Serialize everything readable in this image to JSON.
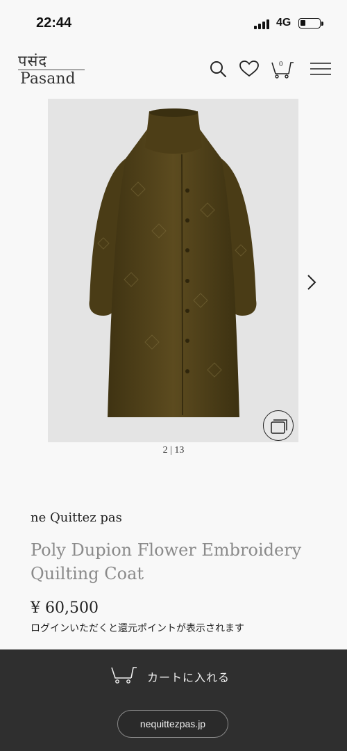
{
  "status_bar": {
    "time": "22:44",
    "network": "4G",
    "battery_level": 0.2
  },
  "header": {
    "logo_hindi": "पसंद",
    "logo_latin": "Pasand",
    "cart_count": "0",
    "icons": [
      "search-icon",
      "heart-icon",
      "cart-icon",
      "menu-icon"
    ]
  },
  "gallery": {
    "page_indicator": "2 | 13",
    "current": 2,
    "total": 13
  },
  "product": {
    "brand": "ne Quittez pas",
    "title": "Poly Dupion Flower Embroidery Quilting Coat",
    "price": "¥ 60,500",
    "points_note": "ログインいただくと還元ポイントが表示されます"
  },
  "bottom_bar": {
    "add_to_cart_label": "カートに入れる",
    "site_label": "nequittezpas.jp"
  },
  "colors": {
    "accent_dark": "#2f2f2f",
    "coat": "#5a4a1e",
    "title_gray": "#8a8a8a"
  }
}
